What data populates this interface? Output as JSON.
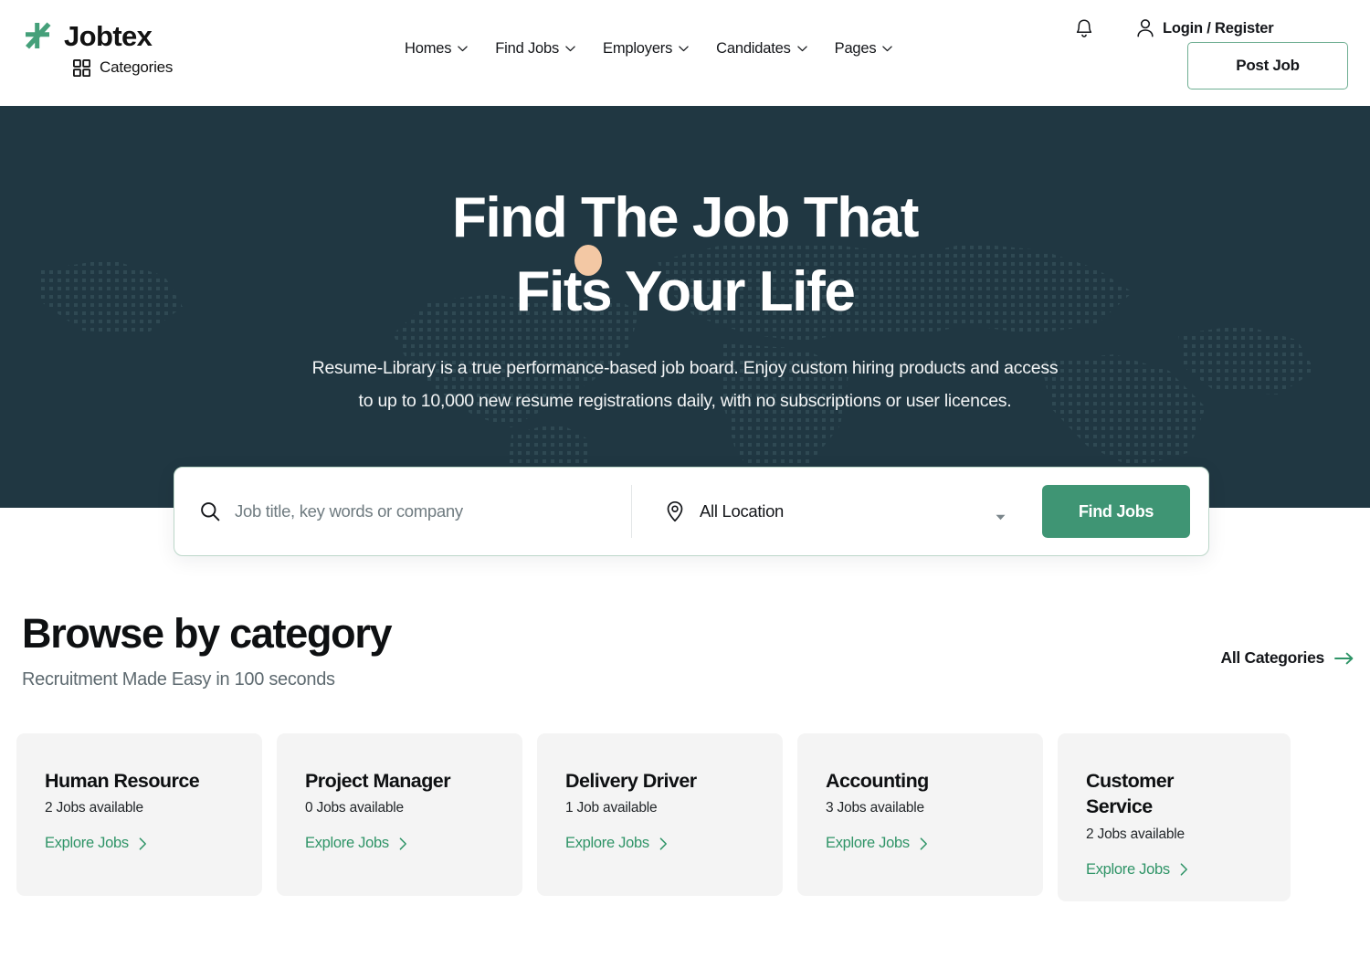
{
  "brand": {
    "name": "Jobtex",
    "categories_label": "Categories",
    "logo_icon": "jobtex-logo-icon",
    "grid_icon": "grid-icon",
    "accent_green": "#3f9574",
    "logo_green": "#45a07a"
  },
  "nav": {
    "items": [
      {
        "label": "Homes",
        "icon": "chevron-down-icon"
      },
      {
        "label": "Find Jobs",
        "icon": "chevron-down-icon"
      },
      {
        "label": "Employers",
        "icon": "chevron-down-icon"
      },
      {
        "label": "Candidates",
        "icon": "chevron-down-icon"
      },
      {
        "label": "Pages",
        "icon": "chevron-down-icon"
      }
    ]
  },
  "header_right": {
    "bell_icon": "notification-bell-icon",
    "user_icon": "user-account-icon",
    "account_label": "Login / Register",
    "post_job_label": "Post Job"
  },
  "hero": {
    "title_line1": "Find The Job That",
    "title_line2": "Fits Your Life",
    "subtitle_line1": "Resume-Library is a true performance-based job board. Enjoy custom hiring products and access",
    "subtitle_line2": "to up to 10,000 new resume registrations daily, with no subscriptions or user licences.",
    "background_color": "#203742",
    "blob_color": "#f3c8a4"
  },
  "search": {
    "keyword_icon": "search-icon",
    "keyword_placeholder": "Job title, key words or company",
    "keyword_value": "",
    "location_icon": "map-pin-icon",
    "location_value": "All Location",
    "location_caret_icon": "caret-down-icon",
    "submit_label": "Find Jobs"
  },
  "categories": {
    "title": "Browse by category",
    "subtitle": "Recruitment Made Easy in 100 seconds",
    "all_link_label": "All Categories",
    "all_link_icon": "arrow-right-icon",
    "explore_label": "Explore Jobs",
    "explore_icon": "chevron-right-icon",
    "cards": [
      {
        "title": "Human Resource",
        "count": "2 Jobs available",
        "link": "Explore Jobs"
      },
      {
        "title": "Project Manager",
        "count": "0 Jobs available",
        "link": "Explore Jobs"
      },
      {
        "title": "Delivery Driver",
        "count": "1 Job available",
        "link": "Explore Jobs"
      },
      {
        "title": "Accounting",
        "count": "3 Jobs available",
        "link": "Explore Jobs"
      },
      {
        "title": "Customer Service",
        "count": "2 Jobs available",
        "link": "Explore Jobs"
      }
    ]
  }
}
